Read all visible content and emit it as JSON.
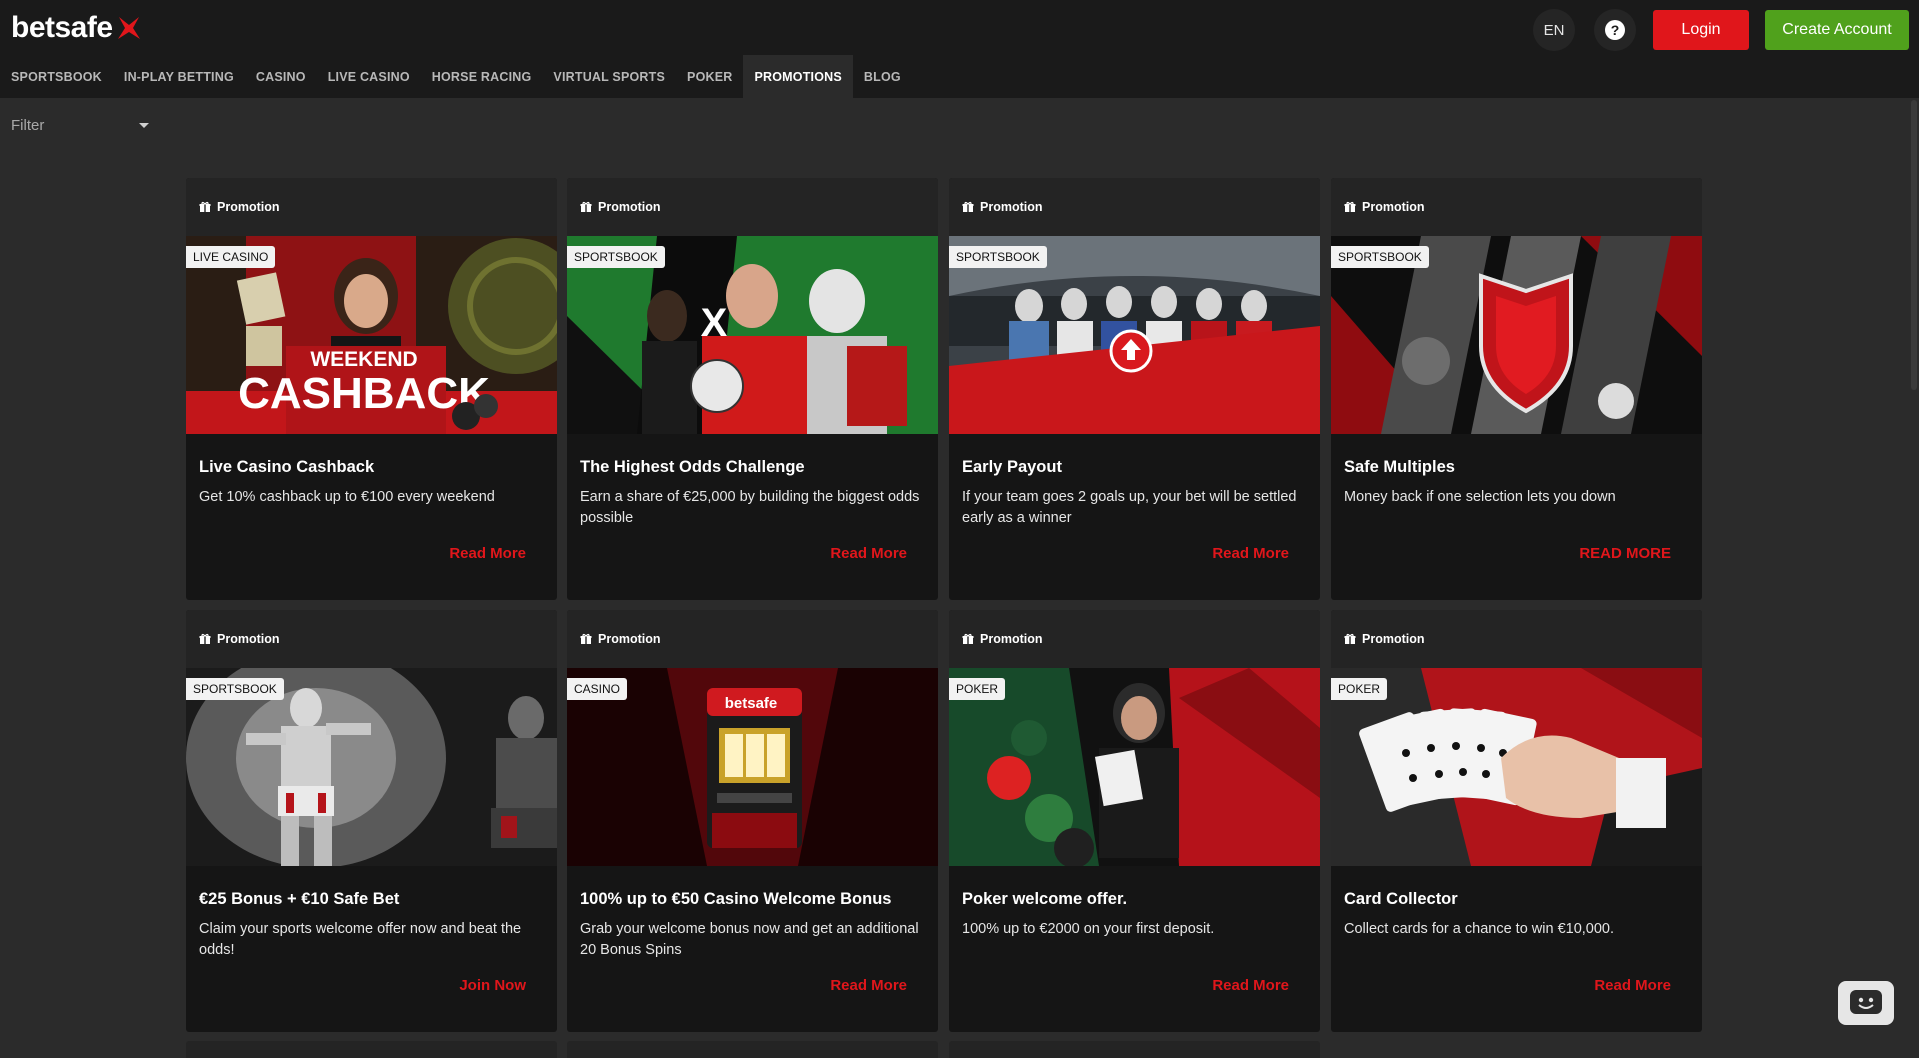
{
  "header": {
    "logo": "betsafe",
    "lang": "EN",
    "help": "?",
    "login": "Login",
    "create_account": "Create Account"
  },
  "nav": [
    "SPORTSBOOK",
    "IN-PLAY BETTING",
    "CASINO",
    "LIVE CASINO",
    "HORSE RACING",
    "VIRTUAL SPORTS",
    "POKER",
    "PROMOTIONS",
    "BLOG"
  ],
  "nav_active": "PROMOTIONS",
  "filter": {
    "label": "Filter"
  },
  "cards": [
    {
      "header": "Promotion",
      "tag": "LIVE CASINO",
      "image_text": [
        "WEEKEND",
        "CASHBACK"
      ],
      "title": "Live Casino Cashback",
      "desc": "Get 10% cashback up to €100 every weekend",
      "link": "Read More"
    },
    {
      "header": "Promotion",
      "tag": "SPORTSBOOK",
      "title": "The Highest Odds Challenge",
      "desc": "Earn a share of €25,000 by building the biggest odds possible",
      "link": "Read More"
    },
    {
      "header": "Promotion",
      "tag": "SPORTSBOOK",
      "title": "Early Payout",
      "desc": "If your team goes 2 goals up, your bet will be settled early as a winner",
      "link": "Read More"
    },
    {
      "header": "Promotion",
      "tag": "SPORTSBOOK",
      "title": "Safe Multiples",
      "desc": "Money back if one selection lets you down",
      "link": "READ MORE"
    },
    {
      "header": "Promotion",
      "tag": "SPORTSBOOK",
      "title": "€25 Bonus + €10 Safe Bet",
      "desc": "Claim your sports welcome offer now and beat the odds!",
      "link": "Join Now"
    },
    {
      "header": "Promotion",
      "tag": "CASINO",
      "image_text": [
        "betsafe"
      ],
      "title": "100% up to €50 Casino Welcome Bonus",
      "desc": "Grab your welcome bonus now and get an additional 20 Bonus Spins",
      "link": "Read More"
    },
    {
      "header": "Promotion",
      "tag": "POKER",
      "title": "Poker welcome offer.",
      "desc": "100% up to €2000 on your first deposit.",
      "link": "Read More"
    },
    {
      "header": "Promotion",
      "tag": "POKER",
      "title": "Card Collector",
      "desc": "Collect cards for a chance to win €10,000.",
      "link": "Read More"
    }
  ],
  "colors": {
    "brand_red": "#e0161b",
    "create_green": "#50a11c",
    "header_bg": "#1a1a1a",
    "page_bg": "#2b2b2b"
  }
}
